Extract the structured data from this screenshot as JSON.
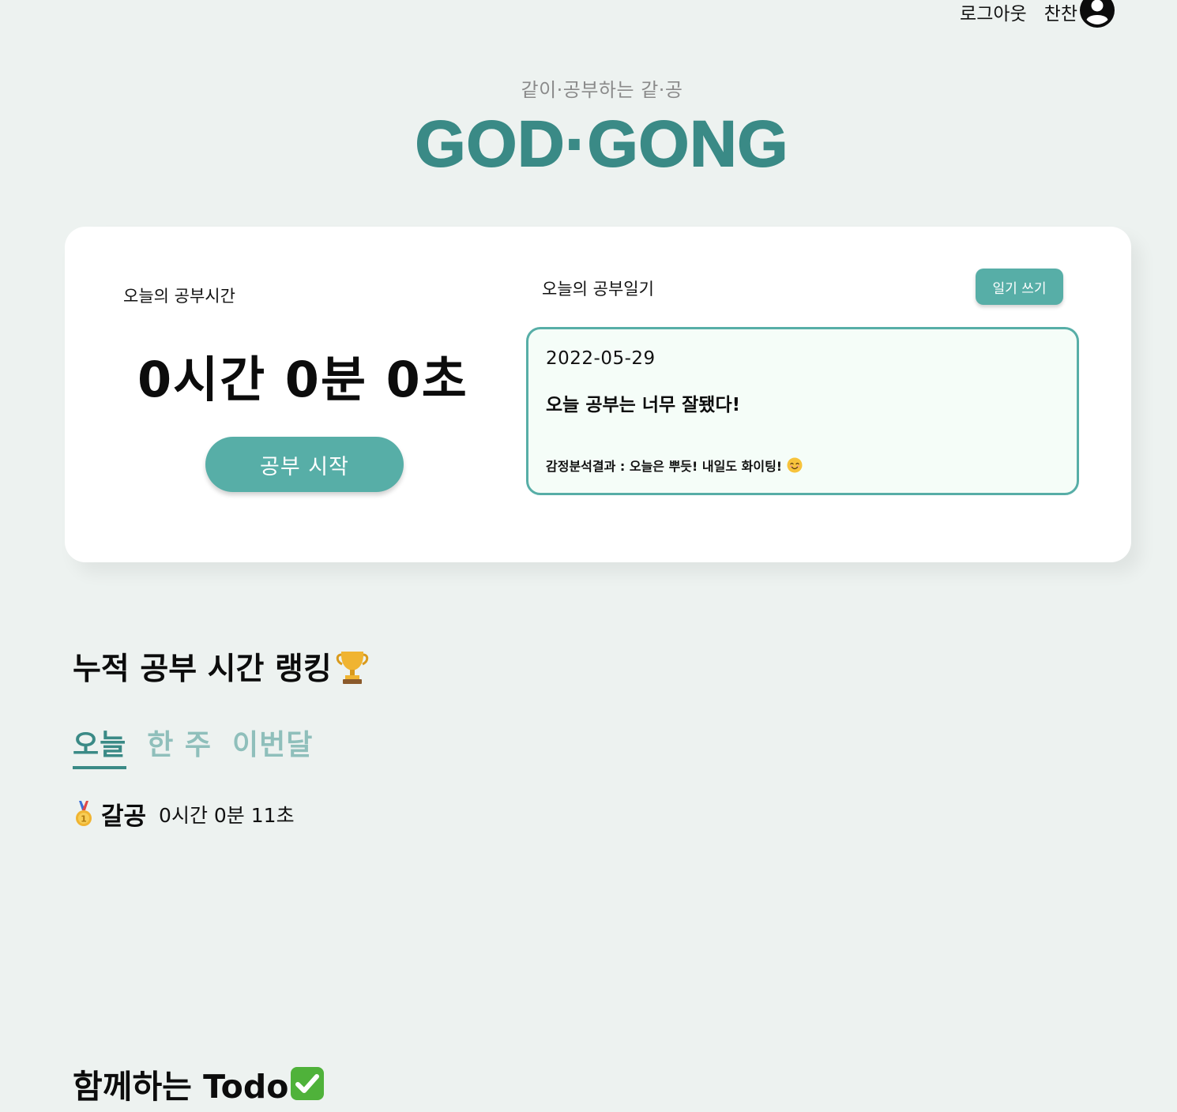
{
  "nav": {
    "logout_label": "로그아웃",
    "username": "찬찬",
    "avatar_icon": "user-circle-icon"
  },
  "hero": {
    "tagline": "같이·공부하는 같·공",
    "logo": "GOD·GONG"
  },
  "study": {
    "label": "오늘의 공부시간",
    "timer": "0시간 0분 0초",
    "start_button": "공부 시작"
  },
  "diary": {
    "label": "오늘의 공부일기",
    "write_button": "일기 쓰기",
    "date": "2022-05-29",
    "title": "오늘 공부는 너무 잘됐다!",
    "emotion": "감정분석결과 : 오늘은 뿌듯! 내일도 화이팅!",
    "emotion_icon": "smiling-face-icon"
  },
  "ranking": {
    "title": "누적 공부 시간 랭킹",
    "title_icon": "trophy-icon",
    "tabs": [
      "오늘",
      "한 주",
      "이번달"
    ],
    "active_tab": 0,
    "rows": [
      {
        "medal_icon": "gold-medal-icon",
        "name": "갈공",
        "time": "0시간 0분 11초"
      }
    ]
  },
  "todo": {
    "title": "함께하는 Todo",
    "title_icon": "check-mark-button-icon"
  },
  "colors": {
    "background": "#edf2f0",
    "accent": "#57aea7",
    "brand": "#3a8a86",
    "tab_inactive": "#8fbfbb",
    "diary_bg": "#f5fdf8"
  }
}
